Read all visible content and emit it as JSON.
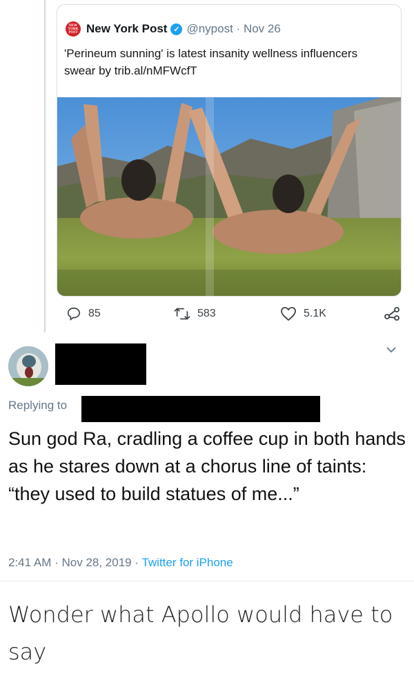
{
  "quoted_tweet": {
    "author_name": "New York Post",
    "author_handle": "@nypost",
    "date": "Nov 26",
    "logo_text": "NEW YORK POST",
    "text": "'Perineum sunning' is latest insanity wellness influencers swear by trib.al/nMFWcfT",
    "photo_icon": "photo-of-two-people-sunbathing-legs-up-on-grass"
  },
  "actions": {
    "replies": "85",
    "retweets": "583",
    "likes": "5.1K"
  },
  "reply": {
    "replying_label": "Replying to",
    "text": "Sun god Ra, cradling a coffee cup in both hands as he stares down at a chorus line of taints: “they used to build statues of me...”",
    "time": "2:41 AM",
    "date": "Nov 28, 2019",
    "source": "Twitter for iPhone"
  },
  "caption": "Wonder what Apollo would have to say",
  "colors": {
    "accent": "#1da1f2",
    "muted": "#657786",
    "nypost_red": "#d2232a"
  }
}
